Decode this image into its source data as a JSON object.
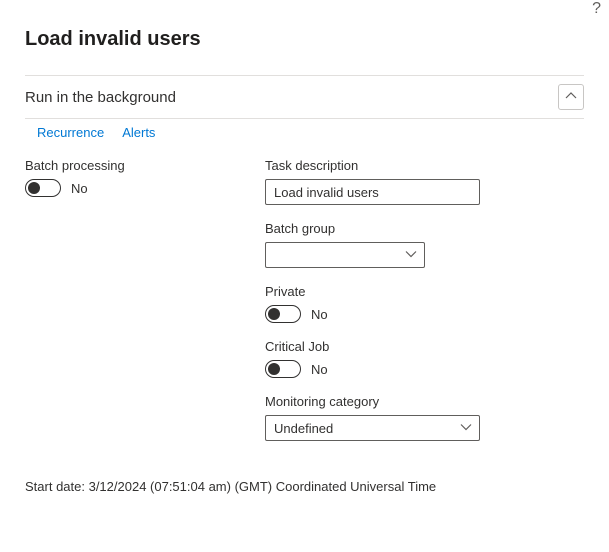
{
  "help": "?",
  "pageTitle": "Load invalid users",
  "section": {
    "title": "Run in the background"
  },
  "tabs": {
    "recurrence": "Recurrence",
    "alerts": "Alerts"
  },
  "fields": {
    "batchProcessing": {
      "label": "Batch processing",
      "value": "No"
    },
    "taskDescription": {
      "label": "Task description",
      "value": "Load invalid users"
    },
    "batchGroup": {
      "label": "Batch group",
      "value": ""
    },
    "private": {
      "label": "Private",
      "value": "No"
    },
    "criticalJob": {
      "label": "Critical Job",
      "value": "No"
    },
    "monitoringCategory": {
      "label": "Monitoring category",
      "value": "Undefined"
    }
  },
  "startDate": "Start date: 3/12/2024 (07:51:04 am) (GMT) Coordinated Universal Time"
}
